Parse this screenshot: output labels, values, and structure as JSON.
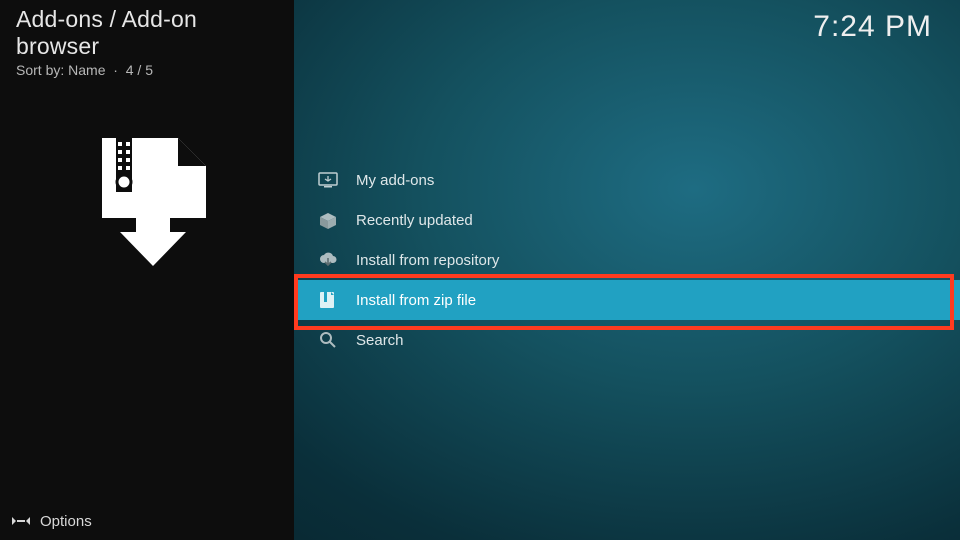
{
  "header": {
    "breadcrumb": "Add-ons / Add-on browser",
    "sort_label": "Sort by:",
    "sort_value": "Name",
    "position": "4 / 5"
  },
  "clock": "7:24 PM",
  "menu": {
    "items": [
      {
        "label": "My add-ons",
        "icon": "screen-icon"
      },
      {
        "label": "Recently updated",
        "icon": "box-open-icon"
      },
      {
        "label": "Install from repository",
        "icon": "cloud-download-icon"
      },
      {
        "label": "Install from zip file",
        "icon": "zip-file-icon"
      },
      {
        "label": "Search",
        "icon": "search-icon"
      }
    ],
    "selected_index": 3
  },
  "footer": {
    "options_label": "Options"
  }
}
